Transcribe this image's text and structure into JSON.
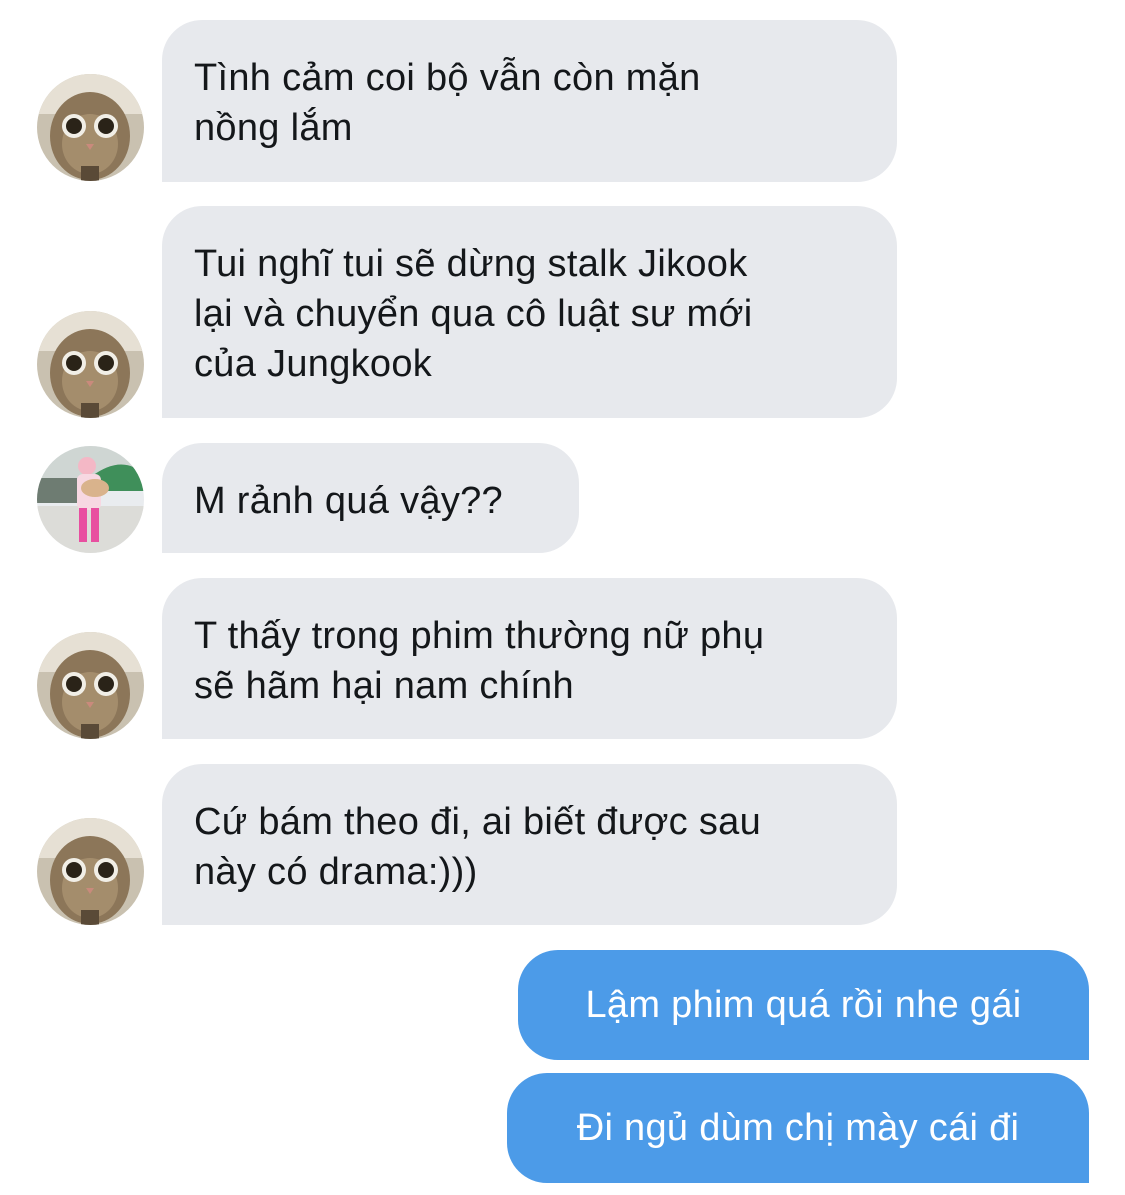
{
  "messages": [
    {
      "sender": "other",
      "avatar_icon": "cat-avatar-icon",
      "lines": [
        "Tình cảm coi bộ vẫn còn mặn",
        "nồng lắm"
      ]
    },
    {
      "sender": "other",
      "avatar_icon": "cat-avatar-icon",
      "lines": [
        "Tui nghĩ tui sẽ dừng stalk Jikook",
        "lại và chuyển qua cô luật sư mới",
        "của Jungkook"
      ]
    },
    {
      "sender": "other",
      "avatar_icon": "person-with-dog-avatar-icon",
      "lines": [
        "M rảnh quá vậy??"
      ]
    },
    {
      "sender": "other",
      "avatar_icon": "cat-avatar-icon",
      "lines": [
        "T thấy trong phim thường nữ phụ",
        "sẽ hãm hại nam chính"
      ]
    },
    {
      "sender": "other",
      "avatar_icon": "cat-avatar-icon",
      "lines": [
        "Cứ bám theo đi, ai biết được sau",
        "này có drama:)))"
      ]
    },
    {
      "sender": "me",
      "lines": [
        "Lậm phim quá rồi nhe gái"
      ]
    },
    {
      "sender": "me",
      "lines": [
        "Đi ngủ dùm chị mày cái đi"
      ]
    }
  ],
  "colors": {
    "incoming_bubble": "#e7e9ed",
    "incoming_text": "#14171a",
    "outgoing_bubble": "#4c9be8",
    "outgoing_text": "#ffffff"
  }
}
